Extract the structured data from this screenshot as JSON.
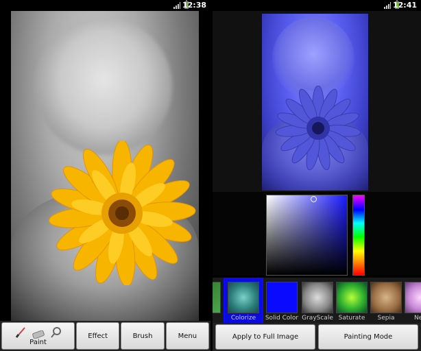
{
  "left_screen": {
    "status": {
      "time": "12:38"
    },
    "toolbar": {
      "paint_label": "Paint",
      "effect_label": "Effect",
      "brush_label": "Brush",
      "menu_label": "Menu"
    },
    "icons": [
      "brush-icon",
      "eraser-icon",
      "magnifier-icon"
    ]
  },
  "right_screen": {
    "status": {
      "time": "12:41"
    },
    "effects": [
      {
        "label": "",
        "icon": "effect-partial-green"
      },
      {
        "label": "Colorize",
        "icon": "effect-colorize",
        "selected": true
      },
      {
        "label": "Solid Color",
        "icon": "effect-solid-color"
      },
      {
        "label": "GrayScale",
        "icon": "effect-grayscale"
      },
      {
        "label": "Saturate",
        "icon": "effect-saturate"
      },
      {
        "label": "Sepia",
        "icon": "effect-sepia"
      },
      {
        "label": "Neg",
        "icon": "effect-negative"
      }
    ],
    "toolbar": {
      "apply_label": "Apply to Full Image",
      "mode_label": "Painting Mode"
    },
    "colors": {
      "selected_color": "#1a1aff",
      "selection_highlight": "#0b0bff"
    }
  }
}
